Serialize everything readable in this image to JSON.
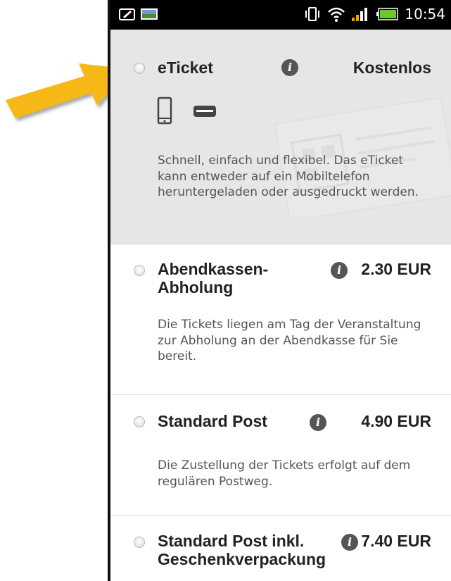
{
  "statusbar": {
    "time": "10:54"
  },
  "options": [
    {
      "title": "eTicket",
      "price": "Kostenlos",
      "description": "Schnell, einfach und flexibel. Das eTicket kann entweder auf ein Mobiltelefon heruntergeladen oder ausgedruckt werden."
    },
    {
      "title": "Abendkassen-Abholung",
      "title_line1": "Abendkassen-",
      "title_line2": "Abholung",
      "price": "2.30 EUR",
      "description": "Die Tickets liegen am Tag der Veranstaltung zur Abholung an der Abendkasse für Sie bereit."
    },
    {
      "title": "Standard Post",
      "price": "4.90 EUR",
      "description": "Die Zustellung der Tickets erfolgt auf dem regulären Postweg."
    },
    {
      "title": "Standard Post inkl. Geschenkverpackung",
      "title_line1": "Standard Post inkl.",
      "title_line2": "Geschenkverpackung",
      "price": "7.40 EUR"
    }
  ],
  "colors": {
    "arrow": "#f6b817",
    "selected_bg": "#e6e6e6",
    "info_icon": "#555555"
  },
  "info_glyph": "i"
}
